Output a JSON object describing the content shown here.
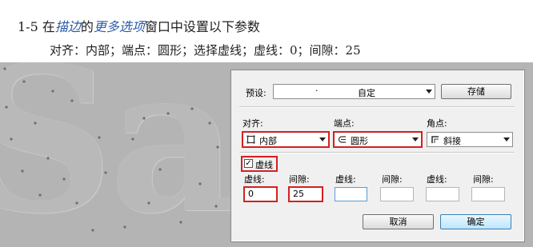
{
  "instructions": {
    "step_number": "1-5",
    "step_text_1": "在",
    "step_link_1": "描边",
    "step_text_2": "的",
    "step_link_2": "更多选项",
    "step_text_3": "窗口中设置以下参数",
    "params": "对齐：内部；端点：圆形；选择虚线；虚线：0；间隙：25"
  },
  "canvas": {
    "letters": "Sa"
  },
  "dialog": {
    "preset_label": "预设:",
    "preset_value": "自定",
    "preset_dot": "·",
    "save_button": "存储",
    "align_label": "对齐:",
    "align_value": "内部",
    "cap_label": "端点:",
    "cap_value": "圆形",
    "corner_label": "角点:",
    "corner_value": "斜接",
    "dashed_label": "虚线",
    "dashed_checked": true,
    "dash_labels": [
      "虚线:",
      "间隙:",
      "虚线:",
      "间隙:",
      "虚线:",
      "间隙:"
    ],
    "dash_values": [
      "0",
      "25",
      "",
      "",
      "",
      ""
    ],
    "cancel_button": "取消",
    "ok_button": "确定"
  }
}
